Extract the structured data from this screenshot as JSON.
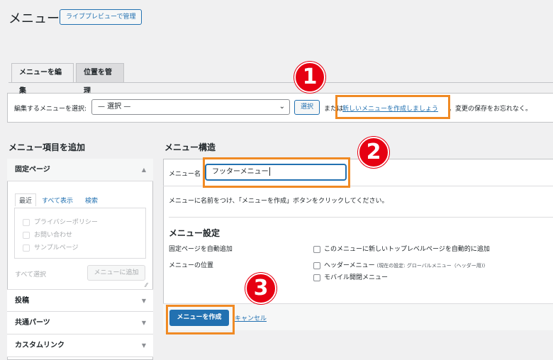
{
  "header": {
    "title": "メニュー",
    "live_preview_button": "ライブプレビューで管理"
  },
  "tabs": [
    {
      "label": "メニューを編集",
      "active": true
    },
    {
      "label": "位置を管理",
      "active": false
    }
  ],
  "select_bar": {
    "label": "編集するメニューを選択:",
    "selected": "— 選択 —",
    "select_button": "選択",
    "or_text": "または",
    "create_link": "新しいメニューを作成しましょう",
    "save_note": "。変更の保存をお忘れなく。"
  },
  "left": {
    "heading": "メニュー項目を追加",
    "accordions": [
      {
        "label": "固定ページ",
        "open": true
      },
      {
        "label": "投稿",
        "open": false
      },
      {
        "label": "共通パーツ",
        "open": false
      },
      {
        "label": "カスタムリンク",
        "open": false
      }
    ],
    "inner_tabs": [
      "最近",
      "すべて表示",
      "検索"
    ],
    "pages": [
      "プライバシーポリシー",
      "お問い合わせ",
      "サンプルページ"
    ],
    "select_all": "すべて選択",
    "add_button": "メニューに追加"
  },
  "right": {
    "heading": "メニュー構造",
    "name_label": "メニュー名",
    "name_value": "フッターメニュー",
    "instruction": "メニューに名前をつけ、「メニューを作成」ボタンをクリックしてください。",
    "settings_heading": "メニュー設定",
    "auto_add_label": "固定ページを自動追加",
    "auto_add_option": "このメニューに新しいトップレベルページを自動的に追加",
    "position_label": "メニューの位置",
    "positions": [
      {
        "label": "ヘッダーメニュー",
        "note": "(現在の設定: グローバルメニュー（ヘッダー用))"
      },
      {
        "label": "モバイル開閉メニュー",
        "note": ""
      }
    ],
    "create_button": "メニューを作成",
    "cancel_link": "キャンセル"
  },
  "markers": [
    "1",
    "2",
    "3"
  ],
  "colors": {
    "accent": "#2271b1",
    "highlight": "#f08a24",
    "marker": "#e60012"
  }
}
